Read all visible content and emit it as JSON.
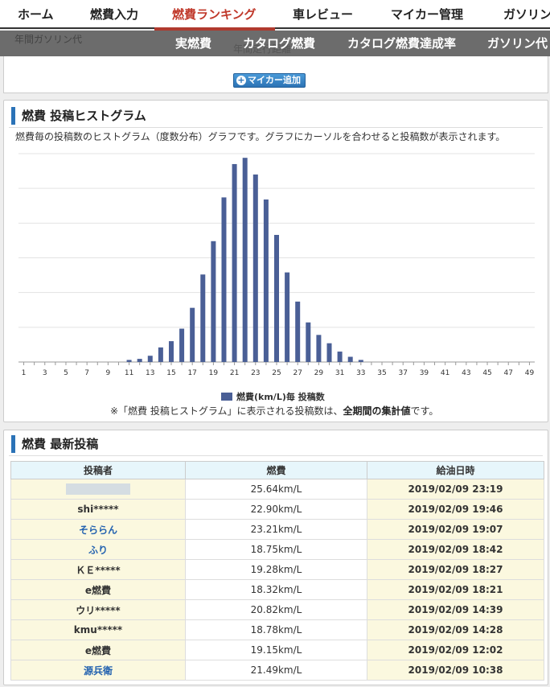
{
  "nav": {
    "items": [
      "ホーム",
      "燃費入力",
      "燃費ランキング",
      "車レビュー",
      "マイカー管理",
      "ガソリン"
    ],
    "active": "燃費ランキング"
  },
  "subnav": {
    "items": [
      "実燃費",
      "カタログ燃費",
      "カタログ燃費達成率",
      "ガソリン代"
    ],
    "ghost_left": "年間ガソリン代",
    "ghost_mid": "年間走行距離"
  },
  "add_car_label": "マイカー追加",
  "histogram": {
    "title": "燃費 投稿ヒストグラム",
    "description": "燃費毎の投稿数のヒストグラム（度数分布）グラフです。グラフにカーソルを合わせると投稿数が表示されます。",
    "legend": "燃費(km/L)毎 投稿数",
    "note_prefix": "※「燃費 投稿ヒストグラム」に表示される投稿数は、",
    "note_bold": "全期間の集計値",
    "note_suffix": "です。"
  },
  "chart_data": {
    "type": "bar",
    "x_ticks": [
      1,
      3,
      5,
      7,
      9,
      11,
      13,
      15,
      17,
      19,
      21,
      23,
      25,
      27,
      29,
      31,
      33,
      35,
      37,
      39,
      41,
      43,
      45,
      47,
      49
    ],
    "categories": [
      1,
      2,
      3,
      4,
      5,
      6,
      7,
      8,
      9,
      10,
      11,
      12,
      13,
      14,
      15,
      16,
      17,
      18,
      19,
      20,
      21,
      22,
      23,
      24,
      25,
      26,
      27,
      28,
      29,
      30,
      31,
      32,
      33,
      34,
      35,
      36,
      37,
      38,
      39,
      40,
      41,
      42,
      43,
      44,
      45,
      46,
      47,
      48,
      49
    ],
    "values": [
      0,
      0,
      0,
      0,
      0,
      0,
      0,
      0,
      0,
      0,
      1,
      1.5,
      3,
      7,
      10,
      16,
      26,
      42,
      58,
      79,
      95,
      98,
      90,
      78,
      61,
      43,
      29,
      19,
      13,
      9,
      5,
      2.5,
      1,
      0,
      0,
      0,
      0,
      0,
      0,
      0,
      0,
      0,
      0,
      0,
      0,
      0,
      0,
      0,
      0
    ],
    "series_name": "燃費(km/L)毎 投稿数",
    "grid": true,
    "legend_position": "bottom",
    "color": "#4a5f96"
  },
  "latest": {
    "title": "燃費 最新投稿",
    "headers": [
      "投稿者",
      "燃費",
      "給油日時"
    ],
    "rows": [
      {
        "poster": "",
        "fuel": "25.64km/L",
        "date": "2019/02/09 23:19",
        "link": false,
        "blurred": true
      },
      {
        "poster": "shi*****",
        "fuel": "22.90km/L",
        "date": "2019/02/09 19:46",
        "link": false,
        "blurred": false
      },
      {
        "poster": "そららん",
        "fuel": "23.21km/L",
        "date": "2019/02/09 19:07",
        "link": true,
        "blurred": false
      },
      {
        "poster": "ふり",
        "fuel": "18.75km/L",
        "date": "2019/02/09 18:42",
        "link": true,
        "blurred": false
      },
      {
        "poster": "ＫＥ*****",
        "fuel": "19.28km/L",
        "date": "2019/02/09 18:27",
        "link": false,
        "blurred": false
      },
      {
        "poster": "e燃費",
        "fuel": "18.32km/L",
        "date": "2019/02/09 18:21",
        "link": false,
        "blurred": false
      },
      {
        "poster": "ウリ*****",
        "fuel": "20.82km/L",
        "date": "2019/02/09 14:39",
        "link": false,
        "blurred": false
      },
      {
        "poster": "kmu*****",
        "fuel": "18.78km/L",
        "date": "2019/02/09 14:28",
        "link": false,
        "blurred": false
      },
      {
        "poster": "e燃費",
        "fuel": "19.15km/L",
        "date": "2019/02/09 12:02",
        "link": false,
        "blurred": false
      },
      {
        "poster": "源兵衛",
        "fuel": "21.49km/L",
        "date": "2019/02/09 10:38",
        "link": true,
        "blurred": false
      }
    ]
  }
}
